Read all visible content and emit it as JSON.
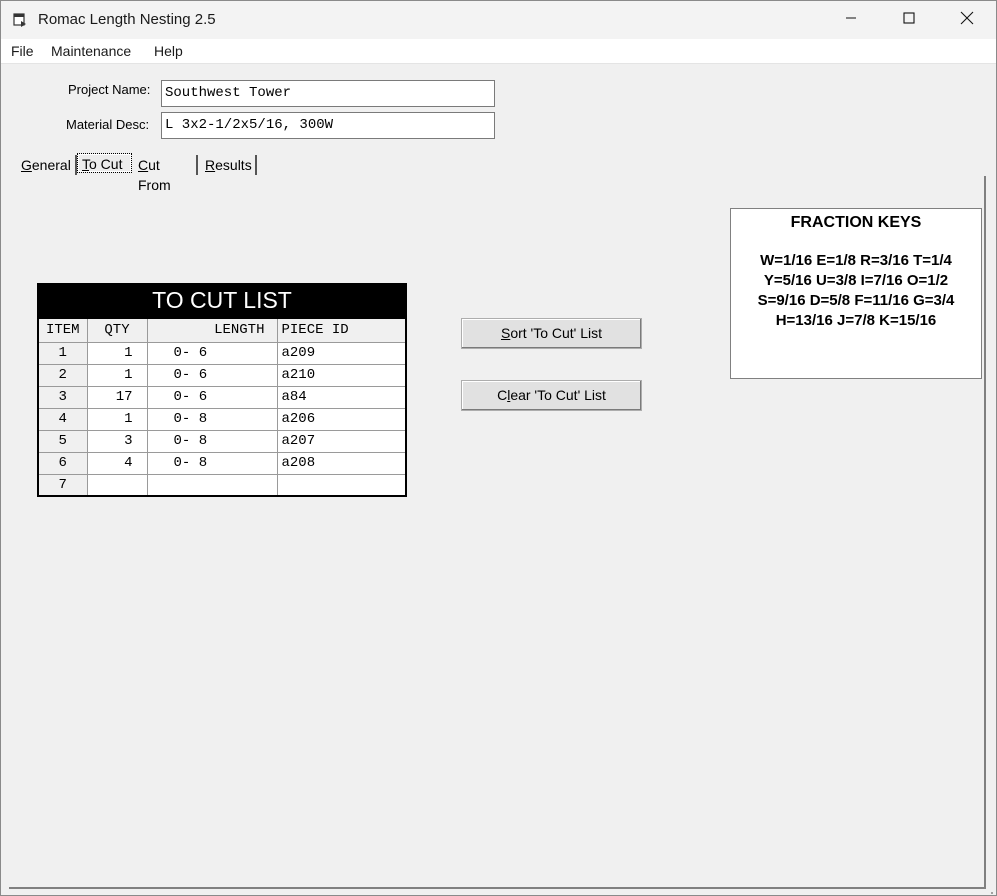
{
  "window": {
    "title": "Romac Length Nesting 2.5"
  },
  "menu": {
    "items": [
      "File",
      "Maintenance",
      "Help"
    ]
  },
  "project": {
    "name_label": "Project Name:",
    "name_value": "Southwest Tower",
    "material_label": "Material Desc:",
    "material_value": "L 3x2-1/2x5/16, 300W"
  },
  "tabs": [
    {
      "label": "General",
      "mnemonic": "G"
    },
    {
      "label": "To Cut",
      "mnemonic": "T"
    },
    {
      "label": "Cut From",
      "mnemonic": "C"
    },
    {
      "label": "Results",
      "mnemonic": "R"
    }
  ],
  "active_tab": "To Cut",
  "to_cut": {
    "title": "TO CUT LIST",
    "headers": {
      "item": "ITEM",
      "qty": "QTY",
      "length": "LENGTH",
      "piece_id": "PIECE ID"
    },
    "rows": [
      {
        "item": "1",
        "qty": "1",
        "length": "0- 6",
        "piece_id": "a209"
      },
      {
        "item": "2",
        "qty": "1",
        "length": "0- 6",
        "piece_id": "a210"
      },
      {
        "item": "3",
        "qty": "17",
        "length": "0- 6",
        "piece_id": "a84"
      },
      {
        "item": "4",
        "qty": "1",
        "length": "0- 8",
        "piece_id": "a206"
      },
      {
        "item": "5",
        "qty": "3",
        "length": "0- 8",
        "piece_id": "a207"
      },
      {
        "item": "6",
        "qty": "4",
        "length": "0- 8",
        "piece_id": "a208"
      },
      {
        "item": "7",
        "qty": "",
        "length": "",
        "piece_id": ""
      }
    ]
  },
  "buttons": {
    "sort": "Sort 'To Cut' List",
    "clear": "Clear 'To Cut' List"
  },
  "fraction_keys": {
    "title": "FRACTION KEYS",
    "lines": [
      "W=1/16  E=1/8  R=3/16  T=1/4",
      "Y=5/16  U=3/8  I=7/16  O=1/2",
      "S=9/16  D=5/8  F=11/16  G=3/4",
      "H=13/16  J=7/8  K=15/16"
    ]
  },
  "icons": {
    "app": "app-window-icon",
    "minimize": "minimize-icon",
    "maximize": "maximize-icon",
    "close": "close-icon"
  }
}
